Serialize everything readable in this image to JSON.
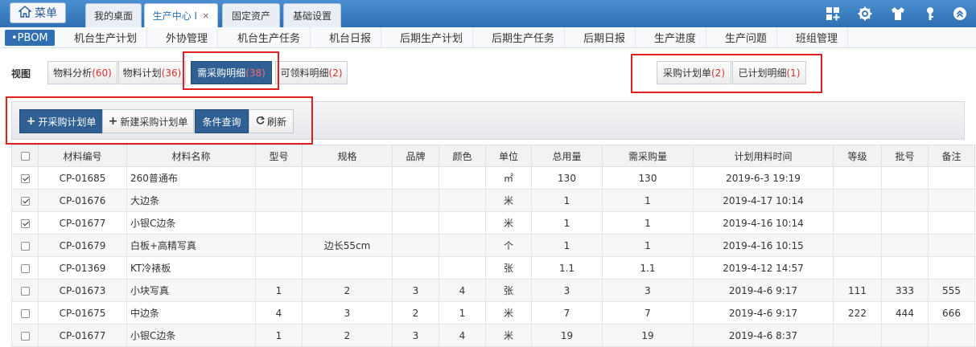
{
  "topbar": {
    "menu_label": "菜单",
    "tabs": [
      {
        "label": "我的桌面"
      },
      {
        "label": "生产中心 I",
        "close": "×"
      },
      {
        "label": "固定资产"
      },
      {
        "label": "基础设置"
      }
    ],
    "icons": [
      "grid-plus-icon",
      "gear-icon",
      "shirt-icon",
      "key-icon",
      "chevron-up-circle-icon"
    ]
  },
  "subnav": {
    "items": [
      {
        "label": "•PBOM"
      },
      {
        "label": "机台生产计划"
      },
      {
        "label": "外协管理"
      },
      {
        "label": "机台生产任务"
      },
      {
        "label": "机台日报"
      },
      {
        "label": "后期生产计划"
      },
      {
        "label": "后期生产任务"
      },
      {
        "label": "后期日报"
      },
      {
        "label": "生产进度"
      },
      {
        "label": "生产问题"
      },
      {
        "label": "班组管理"
      }
    ]
  },
  "view": {
    "label": "视图",
    "buttons": [
      {
        "label": "物料分析",
        "count": "(60)"
      },
      {
        "label": "物料计划",
        "count": "(36)"
      },
      {
        "label": "需采购明细",
        "count": "(38)"
      },
      {
        "label": "可领料明细",
        "count": "(2)"
      }
    ],
    "right_buttons": [
      {
        "label": "采购计划单",
        "count": "(2)"
      },
      {
        "label": "已计划明细",
        "count": "(1)"
      }
    ]
  },
  "toolbar": {
    "open_plan": "开采购计划单",
    "new_plan": "新建采购计划单",
    "query": "条件查询",
    "refresh": "刷新"
  },
  "table": {
    "headers": [
      "材料编号",
      "材料名称",
      "型号",
      "规格",
      "品牌",
      "颜色",
      "单位",
      "总用量",
      "需采购量",
      "计划用料时间",
      "等级",
      "批号",
      "备注"
    ],
    "rows": [
      {
        "checked": true,
        "cells": [
          "CP-01685",
          "260普通布",
          "",
          "",
          "",
          "",
          "㎡",
          "130",
          "130",
          "2019-6-3 19:19",
          "",
          "",
          ""
        ]
      },
      {
        "checked": true,
        "cells": [
          "CP-01676",
          "大边条",
          "",
          "",
          "",
          "",
          "米",
          "1",
          "1",
          "2019-4-17 10:14",
          "",
          "",
          ""
        ]
      },
      {
        "checked": true,
        "cells": [
          "CP-01677",
          "小银C边条",
          "",
          "",
          "",
          "",
          "米",
          "1",
          "1",
          "2019-4-16 10:14",
          "",
          "",
          ""
        ]
      },
      {
        "checked": false,
        "cells": [
          "CP-01679",
          "白板+高精写真",
          "",
          "边长55cm",
          "",
          "",
          "个",
          "1",
          "1",
          "2019-4-16 10:15",
          "",
          "",
          ""
        ]
      },
      {
        "checked": false,
        "cells": [
          "CP-01369",
          "KT冷裱板",
          "",
          "",
          "",
          "",
          "张",
          "1.1",
          "1.1",
          "2019-4-12 14:57",
          "",
          "",
          ""
        ]
      },
      {
        "checked": false,
        "cells": [
          "CP-01673",
          "小块写真",
          "1",
          "2",
          "3",
          "4",
          "张",
          "3",
          "3",
          "2019-4-6 9:17",
          "111",
          "333",
          "555"
        ]
      },
      {
        "checked": false,
        "cells": [
          "CP-01675",
          "中边条",
          "4",
          "3",
          "2",
          "1",
          "米",
          "7",
          "7",
          "2019-4-6 9:17",
          "222",
          "444",
          "666"
        ]
      },
      {
        "checked": false,
        "cells": [
          "CP-01677",
          "小银C边条",
          "1",
          "2",
          "3",
          "4",
          "米",
          "19",
          "19",
          "2019-4-6 8:37",
          "",
          "",
          ""
        ]
      }
    ]
  }
}
